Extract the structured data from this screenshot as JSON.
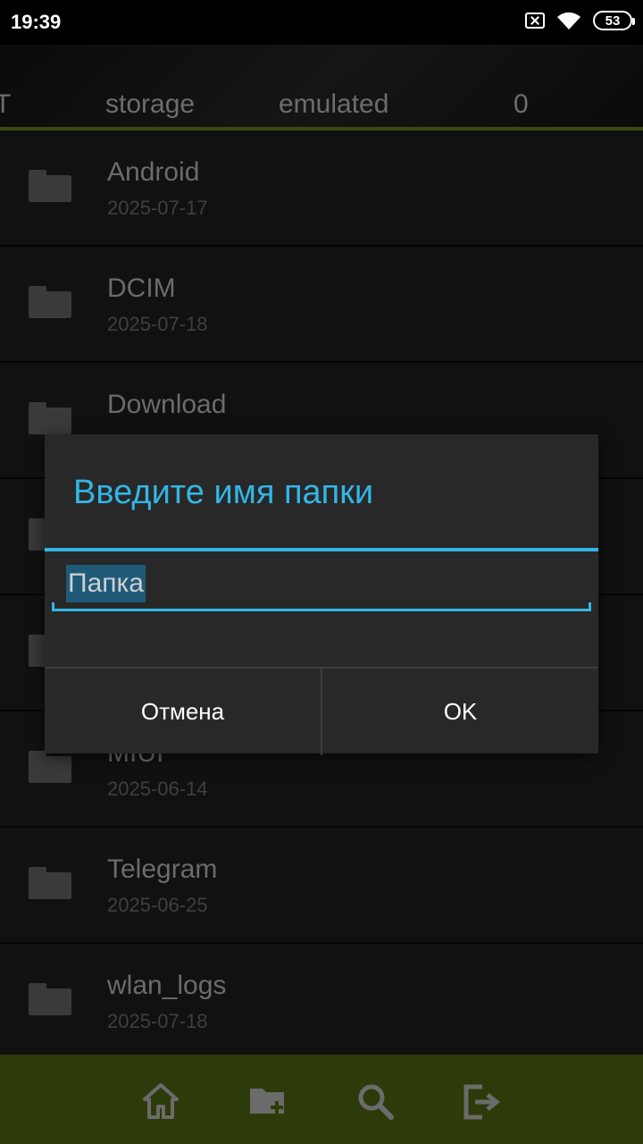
{
  "status": {
    "time": "19:39",
    "battery": "53",
    "icons": [
      "sim-x-icon",
      "wifi-icon",
      "battery-icon"
    ]
  },
  "path": {
    "segments": [
      "T",
      "storage",
      "emulated",
      "0"
    ]
  },
  "files": [
    {
      "name": "Android",
      "date": "2025-07-17"
    },
    {
      "name": "DCIM",
      "date": "2025-07-18"
    },
    {
      "name": "Download",
      "date": ""
    },
    {
      "name": "",
      "date": ""
    },
    {
      "name": "",
      "date": ""
    },
    {
      "name": "MIUI",
      "date": "2025-06-14"
    },
    {
      "name": "Telegram",
      "date": "2025-06-25"
    },
    {
      "name": "wlan_logs",
      "date": "2025-07-18"
    }
  ],
  "dialog": {
    "title": "Введите имя папки",
    "input_value": "Папка",
    "cancel_label": "Отмена",
    "ok_label": "OK"
  },
  "bottom_bar": {
    "icons": [
      "home-icon",
      "new-folder-icon",
      "search-icon",
      "exit-icon"
    ]
  },
  "colors": {
    "accent": "#33b5e5",
    "bottom_bar": "#2d3a0a",
    "path_underline": "#3a4a10"
  }
}
